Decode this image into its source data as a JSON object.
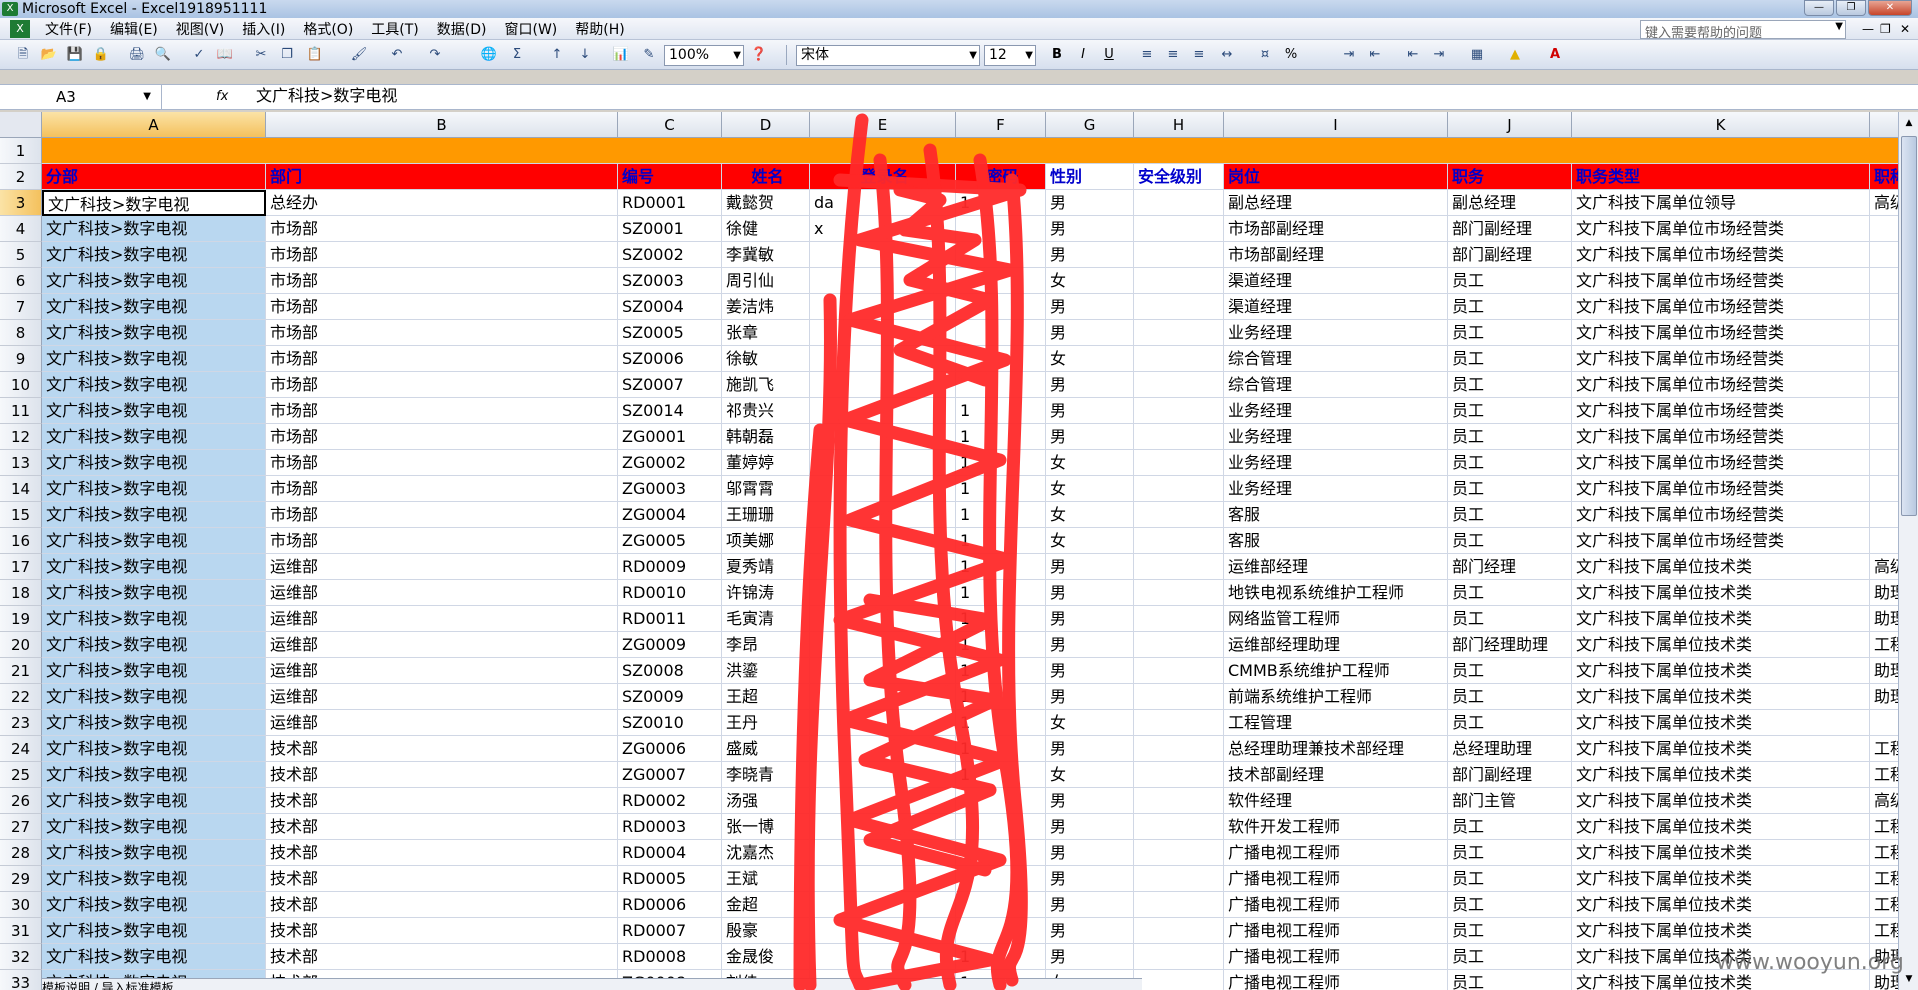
{
  "window": {
    "title": "Microsoft Excel - Excel1918951111"
  },
  "menu": [
    "文件(F)",
    "编辑(E)",
    "视图(V)",
    "插入(I)",
    "格式(O)",
    "工具(T)",
    "数据(D)",
    "窗口(W)",
    "帮助(H)"
  ],
  "help_box": {
    "placeholder": "键入需要帮助的问题"
  },
  "toolbar": {
    "zoom": "100%",
    "font": "宋体",
    "font_size": "12",
    "bold": "B",
    "italic": "I",
    "underline": "U",
    "percent": "%"
  },
  "formula_bar": {
    "name_box": "A3",
    "fx": "fx",
    "formula": "文广科技>数字电视"
  },
  "columns": [
    "A",
    "B",
    "C",
    "D",
    "E",
    "F",
    "G",
    "H",
    "I",
    "J",
    "K"
  ],
  "header_row": {
    "a": "分部",
    "b": "部门",
    "c": "编号",
    "d": "姓名",
    "e": "登录名",
    "f": "密码",
    "g": "性别",
    "h": "安全级别",
    "i": "岗位",
    "j": "职务",
    "k": "职务类型",
    "l": "职称"
  },
  "rows": [
    {
      "n": "3",
      "a": "文广科技>数字电视",
      "b": "总经办",
      "c": "RD0001",
      "d": "戴懿贺",
      "e": "da",
      "f": "1",
      "g": "男",
      "i": "副总经理",
      "j": "副总经理",
      "k": "文广科技下属单位领导",
      "l": "高级"
    },
    {
      "n": "4",
      "a": "文广科技>数字电视",
      "b": "市场部",
      "c": "SZ0001",
      "d": "徐健",
      "e": "x",
      "f": "",
      "g": "男",
      "i": "市场部副经理",
      "j": "部门副经理",
      "k": "文广科技下属单位市场经营类",
      "l": ""
    },
    {
      "n": "5",
      "a": "文广科技>数字电视",
      "b": "市场部",
      "c": "SZ0002",
      "d": "李冀敏",
      "e": "",
      "f": "",
      "g": "男",
      "i": "市场部副经理",
      "j": "部门副经理",
      "k": "文广科技下属单位市场经营类",
      "l": ""
    },
    {
      "n": "6",
      "a": "文广科技>数字电视",
      "b": "市场部",
      "c": "SZ0003",
      "d": "周引仙",
      "e": "",
      "f": "",
      "g": "女",
      "i": "渠道经理",
      "j": "员工",
      "k": "文广科技下属单位市场经营类",
      "l": ""
    },
    {
      "n": "7",
      "a": "文广科技>数字电视",
      "b": "市场部",
      "c": "SZ0004",
      "d": "姜洁炜",
      "e": "",
      "f": "",
      "g": "男",
      "i": "渠道经理",
      "j": "员工",
      "k": "文广科技下属单位市场经营类",
      "l": ""
    },
    {
      "n": "8",
      "a": "文广科技>数字电视",
      "b": "市场部",
      "c": "SZ0005",
      "d": "张章",
      "e": "",
      "f": "",
      "g": "男",
      "i": "业务经理",
      "j": "员工",
      "k": "文广科技下属单位市场经营类",
      "l": ""
    },
    {
      "n": "9",
      "a": "文广科技>数字电视",
      "b": "市场部",
      "c": "SZ0006",
      "d": "徐敏",
      "e": "",
      "f": "",
      "g": "女",
      "i": "综合管理",
      "j": "员工",
      "k": "文广科技下属单位市场经营类",
      "l": ""
    },
    {
      "n": "10",
      "a": "文广科技>数字电视",
      "b": "市场部",
      "c": "SZ0007",
      "d": "施凯飞",
      "e": "",
      "f": "",
      "g": "男",
      "i": "综合管理",
      "j": "员工",
      "k": "文广科技下属单位市场经营类",
      "l": ""
    },
    {
      "n": "11",
      "a": "文广科技>数字电视",
      "b": "市场部",
      "c": "SZ0014",
      "d": "祁贵兴",
      "e": "",
      "f": "1",
      "g": "男",
      "i": "业务经理",
      "j": "员工",
      "k": "文广科技下属单位市场经营类",
      "l": ""
    },
    {
      "n": "12",
      "a": "文广科技>数字电视",
      "b": "市场部",
      "c": "ZG0001",
      "d": "韩朝磊",
      "e": "",
      "f": "1",
      "g": "男",
      "i": "业务经理",
      "j": "员工",
      "k": "文广科技下属单位市场经营类",
      "l": ""
    },
    {
      "n": "13",
      "a": "文广科技>数字电视",
      "b": "市场部",
      "c": "ZG0002",
      "d": "董婷婷",
      "e": "",
      "f": "1",
      "g": "女",
      "i": "业务经理",
      "j": "员工",
      "k": "文广科技下属单位市场经营类",
      "l": ""
    },
    {
      "n": "14",
      "a": "文广科技>数字电视",
      "b": "市场部",
      "c": "ZG0003",
      "d": "邬霄霄",
      "e": "",
      "f": "1",
      "g": "女",
      "i": "业务经理",
      "j": "员工",
      "k": "文广科技下属单位市场经营类",
      "l": ""
    },
    {
      "n": "15",
      "a": "文广科技>数字电视",
      "b": "市场部",
      "c": "ZG0004",
      "d": "王珊珊",
      "e": "",
      "f": "1",
      "g": "女",
      "i": "客服",
      "j": "员工",
      "k": "文广科技下属单位市场经营类",
      "l": ""
    },
    {
      "n": "16",
      "a": "文广科技>数字电视",
      "b": "市场部",
      "c": "ZG0005",
      "d": "项美娜",
      "e": "",
      "f": "1",
      "g": "女",
      "i": "客服",
      "j": "员工",
      "k": "文广科技下属单位市场经营类",
      "l": ""
    },
    {
      "n": "17",
      "a": "文广科技>数字电视",
      "b": "运维部",
      "c": "RD0009",
      "d": "夏秀靖",
      "e": "",
      "f": "1",
      "g": "男",
      "i": "运维部经理",
      "j": "部门经理",
      "k": "文广科技下属单位技术类",
      "l": "高级"
    },
    {
      "n": "18",
      "a": "文广科技>数字电视",
      "b": "运维部",
      "c": "RD0010",
      "d": "许锦涛",
      "e": "",
      "f": "1",
      "g": "男",
      "i": "地铁电视系统维护工程师",
      "j": "员工",
      "k": "文广科技下属单位技术类",
      "l": "助理"
    },
    {
      "n": "19",
      "a": "文广科技>数字电视",
      "b": "运维部",
      "c": "RD0011",
      "d": "毛寅清",
      "e": "",
      "f": "1",
      "g": "男",
      "i": "网络监管工程师",
      "j": "员工",
      "k": "文广科技下属单位技术类",
      "l": "助理"
    },
    {
      "n": "20",
      "a": "文广科技>数字电视",
      "b": "运维部",
      "c": "ZG0009",
      "d": "李昂",
      "e": "",
      "f": "1",
      "g": "男",
      "i": "运维部经理助理",
      "j": "部门经理助理",
      "k": "文广科技下属单位技术类",
      "l": "工程"
    },
    {
      "n": "21",
      "a": "文广科技>数字电视",
      "b": "运维部",
      "c": "SZ0008",
      "d": "洪鎏",
      "e": "",
      "f": "1",
      "g": "男",
      "i": "CMMB系统维护工程师",
      "j": "员工",
      "k": "文广科技下属单位技术类",
      "l": "助理"
    },
    {
      "n": "22",
      "a": "文广科技>数字电视",
      "b": "运维部",
      "c": "SZ0009",
      "d": "王超",
      "e": "",
      "f": "1",
      "g": "男",
      "i": "前端系统维护工程师",
      "j": "员工",
      "k": "文广科技下属单位技术类",
      "l": "助理"
    },
    {
      "n": "23",
      "a": "文广科技>数字电视",
      "b": "运维部",
      "c": "SZ0010",
      "d": "王丹",
      "e": "",
      "f": "1",
      "g": "女",
      "i": "工程管理",
      "j": "员工",
      "k": "文广科技下属单位技术类",
      "l": ""
    },
    {
      "n": "24",
      "a": "文广科技>数字电视",
      "b": "技术部",
      "c": "ZG0006",
      "d": "盛威",
      "e": "",
      "f": "1",
      "g": "男",
      "i": "总经理助理兼技术部经理",
      "j": "总经理助理",
      "k": "文广科技下属单位技术类",
      "l": "工程"
    },
    {
      "n": "25",
      "a": "文广科技>数字电视",
      "b": "技术部",
      "c": "ZG0007",
      "d": "李晓青",
      "e": "",
      "f": "1",
      "g": "女",
      "i": "技术部副经理",
      "j": "部门副经理",
      "k": "文广科技下属单位技术类",
      "l": "工程"
    },
    {
      "n": "26",
      "a": "文广科技>数字电视",
      "b": "技术部",
      "c": "RD0002",
      "d": "汤强",
      "e": "",
      "f": "",
      "g": "男",
      "i": "软件经理",
      "j": "部门主管",
      "k": "文广科技下属单位技术类",
      "l": "高级"
    },
    {
      "n": "27",
      "a": "文广科技>数字电视",
      "b": "技术部",
      "c": "RD0003",
      "d": "张一博",
      "e": "",
      "f": "",
      "g": "男",
      "i": "软件开发工程师",
      "j": "员工",
      "k": "文广科技下属单位技术类",
      "l": "工程"
    },
    {
      "n": "28",
      "a": "文广科技>数字电视",
      "b": "技术部",
      "c": "RD0004",
      "d": "沈嘉杰",
      "e": "",
      "f": "",
      "g": "男",
      "i": "广播电视工程师",
      "j": "员工",
      "k": "文广科技下属单位技术类",
      "l": "工程"
    },
    {
      "n": "29",
      "a": "文广科技>数字电视",
      "b": "技术部",
      "c": "RD0005",
      "d": "王斌",
      "e": "",
      "f": "",
      "g": "男",
      "i": "广播电视工程师",
      "j": "员工",
      "k": "文广科技下属单位技术类",
      "l": "工程"
    },
    {
      "n": "30",
      "a": "文广科技>数字电视",
      "b": "技术部",
      "c": "RD0006",
      "d": "金超",
      "e": "",
      "f": "",
      "g": "男",
      "i": "广播电视工程师",
      "j": "员工",
      "k": "文广科技下属单位技术类",
      "l": "工程"
    },
    {
      "n": "31",
      "a": "文广科技>数字电视",
      "b": "技术部",
      "c": "RD0007",
      "d": "殷豪",
      "e": "",
      "f": "",
      "g": "男",
      "i": "广播电视工程师",
      "j": "员工",
      "k": "文广科技下属单位技术类",
      "l": "工程"
    },
    {
      "n": "32",
      "a": "文广科技>数字电视",
      "b": "技术部",
      "c": "RD0008",
      "d": "金晟俊",
      "e": "",
      "f": "1",
      "g": "男",
      "i": "广播电视工程师",
      "j": "员工",
      "k": "文广科技下属单位技术类",
      "l": "助理"
    },
    {
      "n": "33",
      "a": "文广科技>数字电视",
      "b": "技术部",
      "c": "ZG0008",
      "d": "刘佳",
      "e": "",
      "f": "1",
      "g": "女",
      "i": "广播电视工程师",
      "j": "员工",
      "k": "文广科技下属单位技术类",
      "l": "助理"
    }
  ],
  "sheet_tabs": "模板说明 / 导入标准模板",
  "watermark": "www.wooyun.org",
  "colors": {
    "header_red": "#ff0000",
    "header_text": "#0000cc",
    "orange_row": "#ff9900",
    "col_a_fill": "#b9d7f0",
    "scribble": "#ff2a2a"
  }
}
